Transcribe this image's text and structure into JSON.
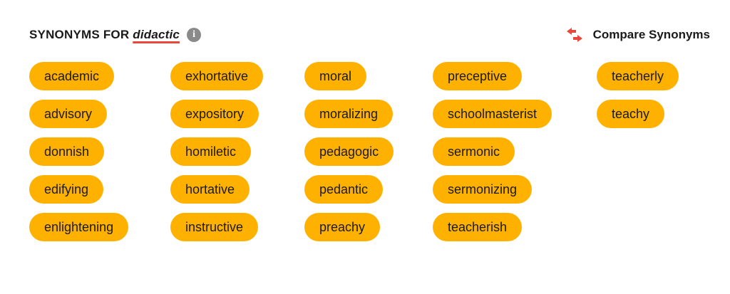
{
  "header": {
    "prefix": "SYNONYMS FOR ",
    "word": "didactic",
    "info_icon": "info-icon",
    "compare_icon": "swap-arrows-icon",
    "compare_label": "Compare Synonyms"
  },
  "colors": {
    "pill_background": "#ffb100",
    "accent_red": "#e8483b",
    "info_gray": "#8a8a8a"
  },
  "synonyms": {
    "col1": [
      "academic",
      "advisory",
      "donnish",
      "edifying",
      "enlightening"
    ],
    "col2": [
      "exhortative",
      "expository",
      "homiletic",
      "hortative",
      "instructive"
    ],
    "col3": [
      "moral",
      "moralizing",
      "pedagogic",
      "pedantic",
      "preachy"
    ],
    "col4": [
      "preceptive",
      "schoolmasterist",
      "sermonic",
      "sermonizing",
      "teacherish"
    ],
    "col5": [
      "teacherly",
      "teachy"
    ]
  }
}
